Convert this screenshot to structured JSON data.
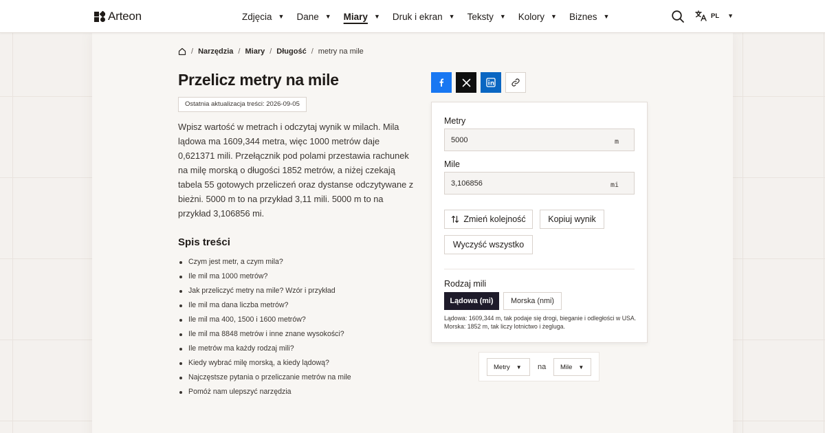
{
  "header": {
    "brand": "Arteon",
    "nav": [
      {
        "label": "Zdjęcia",
        "active": false
      },
      {
        "label": "Dane",
        "active": false
      },
      {
        "label": "Miary",
        "active": true
      },
      {
        "label": "Druk i ekran",
        "active": false
      },
      {
        "label": "Teksty",
        "active": false
      },
      {
        "label": "Kolory",
        "active": false
      },
      {
        "label": "Biznes",
        "active": false
      }
    ],
    "language": "PL"
  },
  "breadcrumb": [
    "Narzędzia",
    "Miary",
    "Długość"
  ],
  "breadcrumb_current": "metry na mile",
  "page": {
    "title": "Przelicz metry na mile",
    "updated": "Ostatnia aktualizacja treści: 2026-09-05",
    "intro": "Wpisz wartość w metrach i odczytaj wynik w milach. Mila lądowa ma 1609,344 metra, więc 1000 metrów daje 0,621371 mili. Przełącznik pod polami przestawia rachunek na milę morską o długości 1852 metrów, a niżej czekają tabela 55 gotowych przeliczeń oraz dystanse odczytywane z bieżni. 5000 m to na przykład 3,11 mili. 5000 m to na przykład 3,106856 mi."
  },
  "toc": {
    "title": "Spis treści",
    "items": [
      "Czym jest metr, a czym mila?",
      "Ile mil ma 1000 metrów?",
      "Jak przeliczyć metry na mile? Wzór i przykład",
      "Ile mil ma dana liczba metrów?",
      "Ile mil ma 400, 1500 i 1600 metrów?",
      "Ile mil ma 8848 metrów i inne znane wysokości?",
      "Ile metrów ma każdy rodzaj mili?",
      "Kiedy wybrać milę morską, a kiedy lądową?",
      "Najczęstsze pytania o przeliczanie metrów na mile",
      "Pomóż nam ulepszyć narzędzia"
    ]
  },
  "converter": {
    "from_label": "Metry",
    "from_value": "5000",
    "from_unit": "m",
    "to_label": "Mile",
    "to_value": "3,106856",
    "to_unit": "mi",
    "swap_label": "Zmień kolejność",
    "copy_label": "Kopiuj wynik",
    "clear_label": "Wyczyść wszystko",
    "mile_type_label": "Rodzaj mili",
    "mile_land": "Lądowa (mi)",
    "mile_sea": "Morska (nmi)",
    "note": "Lądowa: 1609,344 m, tak podaje się drogi, bieganie i odległości w USA. Morska: 1852 m, tak liczy lotnictwo i żegluga."
  },
  "unit_bar": {
    "from": "Metry",
    "joiner": "na",
    "to": "Mile"
  },
  "colors": {
    "facebook": "#1877f2",
    "x": "#0f0f0f",
    "linkedin": "#0a66c2",
    "active_segment": "#1e1b2a"
  }
}
